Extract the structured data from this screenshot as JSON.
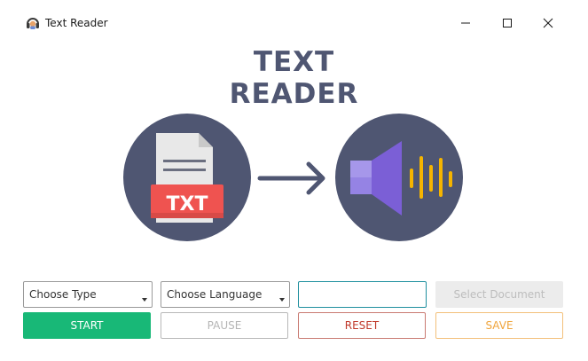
{
  "window": {
    "title": "Text Reader",
    "icon": "headphones-reader-icon",
    "controls": [
      "minimize-icon",
      "maximize-icon",
      "close-icon"
    ]
  },
  "hero": {
    "title_line1": "TEXT",
    "title_line2": "READER",
    "file_badge": "TXT",
    "title_color": "#4f5672"
  },
  "controls": {
    "type_select": "Choose Type",
    "language_select": "Choose Language",
    "text_input_value": "",
    "select_document_label": "Select Document",
    "start_label": "START",
    "pause_label": "PAUSE",
    "reset_label": "RESET",
    "save_label": "SAVE"
  },
  "colors": {
    "start": "#18b877",
    "reset": "#c0392b",
    "save": "#f0a53c",
    "input_border": "#1e8f9e",
    "circle": "#4f5672",
    "badge": "#ef5350",
    "speaker": "#7b5fd6",
    "sound_waves": "#f5b400"
  }
}
